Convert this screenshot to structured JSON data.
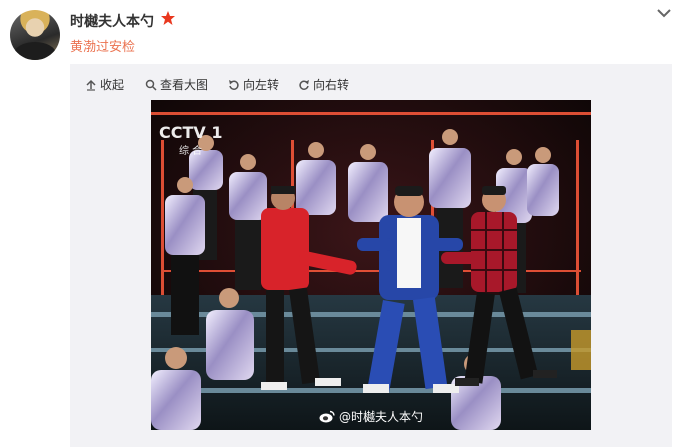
{
  "user": {
    "name": "时樾夫人本勺",
    "badge_icon": "star-icon",
    "badge_color": "#e9371e"
  },
  "post": {
    "text": "黄渤过安检",
    "text_color": "#eb7350"
  },
  "header": {
    "menu_icon": "chevron-down-icon"
  },
  "toolbar": {
    "collapse_label": "收起",
    "view_large_label": "查看大图",
    "rotate_left_label": "向左转",
    "rotate_right_label": "向右转"
  },
  "photo": {
    "channel_logo": "CCTV 1",
    "channel_sub": "综 合",
    "watermark": "@时樾夫人本勺"
  }
}
